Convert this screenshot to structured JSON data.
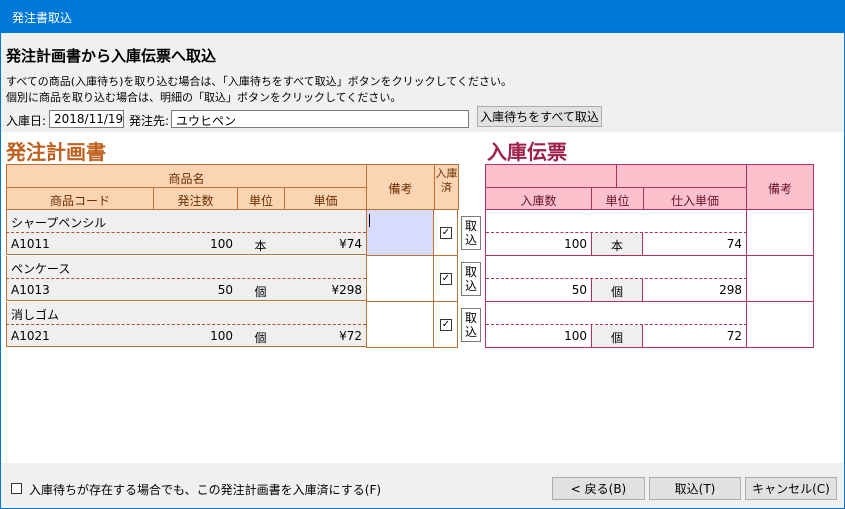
{
  "window": {
    "title": "発注書取込"
  },
  "header": {
    "heading": "発注計画書から入庫伝票へ取込",
    "instruction1": "すべての商品(入庫待ち)を取り込む場合は、「入庫待ちをすべて取込」ボタンをクリックしてください。",
    "instruction2": "個別に商品を取り込む場合は、明細の「取込」ボタンをクリックしてください。"
  },
  "form": {
    "date_label": "入庫日:",
    "date_value": "2018/11/19",
    "supplier_label": "発注先:",
    "supplier_value": "ユウヒペン",
    "import_all_button": "入庫待ちをすべて取込"
  },
  "left_section": {
    "title": "発注計画書",
    "headers": {
      "product_name": "商品名",
      "product_code": "商品コード",
      "order_qty": "発注数",
      "unit": "単位",
      "unit_price": "単価",
      "memo": "備考",
      "received": "入庫済"
    },
    "rows": [
      {
        "name": "シャープペンシル",
        "code": "A1011",
        "qty": "100",
        "unit": "本",
        "price": "¥74",
        "checked": "✓",
        "import_button": "取込"
      },
      {
        "name": "ペンケース",
        "code": "A1013",
        "qty": "50",
        "unit": "個",
        "price": "¥298",
        "checked": "✓",
        "import_button": "取込"
      },
      {
        "name": "消しゴム",
        "code": "A1021",
        "qty": "100",
        "unit": "個",
        "price": "¥72",
        "checked": "✓",
        "import_button": "取込"
      }
    ]
  },
  "right_section": {
    "title": "入庫伝票",
    "headers": {
      "received_qty": "入庫数",
      "unit": "単位",
      "purchase_price": "仕入単価",
      "memo": "備考"
    },
    "rows": [
      {
        "qty": "100",
        "unit": "本",
        "price": "74"
      },
      {
        "qty": "50",
        "unit": "個",
        "price": "298"
      },
      {
        "qty": "100",
        "unit": "個",
        "price": "72"
      }
    ]
  },
  "footer": {
    "mark_complete_label": "入庫待ちが存在する場合でも、この発注計画書を入庫済にする(F)",
    "back_button": "< 戻る(B)",
    "import_button": "取込(T)",
    "cancel_button": "キャンセル(C)"
  },
  "colors": {
    "titlebar": "#0078d7",
    "left_header_bg": "#fbd4b4",
    "right_header_bg": "#fbc1cc",
    "left_title": "#c0601e",
    "right_title": "#a0204c"
  }
}
